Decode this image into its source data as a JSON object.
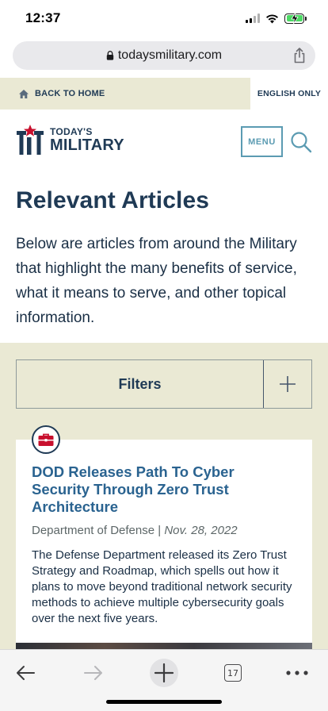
{
  "status": {
    "time": "12:37"
  },
  "browser": {
    "url": "todaysmilitary.com",
    "tab_count": "17"
  },
  "utility": {
    "back_home": "BACK TO HOME",
    "english_only": "ENGLISH ONLY"
  },
  "header": {
    "logo_top": "TODAY'S",
    "logo_bottom": "MILITARY",
    "menu_label": "MENU"
  },
  "main": {
    "title": "Relevant Articles",
    "intro": "Below are articles from around the Military that highlight the many benefits of service, what it means to serve, and other topical information.",
    "filters_label": "Filters"
  },
  "article": {
    "icon": "briefcase-icon",
    "title": "DOD Releases Path To Cyber Security Through Zero Trust Architecture",
    "source": "Department of Defense",
    "separator": "|",
    "date": "Nov. 28, 2022",
    "summary": "The Defense Department released its Zero Trust Strategy and Roadmap, which spells out how it plans to move beyond traditional network security methods to achieve multiple cybersecurity goals over the next five years."
  },
  "colors": {
    "navy": "#1f3a55",
    "accent_blue": "#5b9bb2",
    "link_blue": "#2a6390",
    "beige": "#eae9d4",
    "logo_red": "#c8102e"
  }
}
